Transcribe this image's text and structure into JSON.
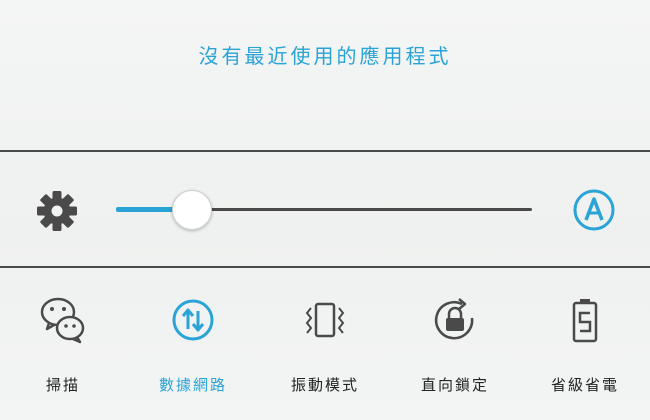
{
  "recent_apps": {
    "empty_text": "沒有最近使用的應用程式"
  },
  "brightness": {
    "level_percent": 18,
    "settings_icon": "gear-icon",
    "auto_icon": "auto-brightness-icon"
  },
  "quick_toggles": [
    {
      "label": "掃描",
      "icon": "wechat-scan-icon",
      "active": false
    },
    {
      "label": "數據網路",
      "icon": "mobile-data-icon",
      "active": true
    },
    {
      "label": "振動模式",
      "icon": "vibrate-icon",
      "active": false
    },
    {
      "label": "直向鎖定",
      "icon": "rotation-lock-icon",
      "active": false
    },
    {
      "label": "省級省電",
      "icon": "battery-saver-icon",
      "active": false
    }
  ],
  "colors": {
    "accent": "#2aa3d6",
    "icon_gray": "#4a4a4a",
    "background": "#f2f4f3"
  }
}
